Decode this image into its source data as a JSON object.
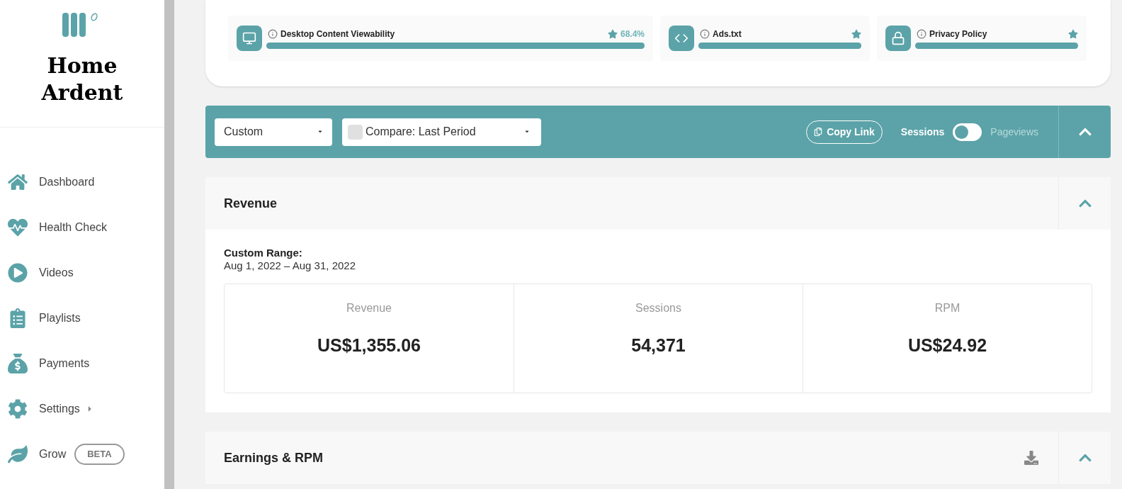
{
  "brand": {
    "name_lines": [
      "Home",
      "Ardent"
    ]
  },
  "sidebar": {
    "items": [
      {
        "label": "Dashboard"
      },
      {
        "label": "Health Check"
      },
      {
        "label": "Videos"
      },
      {
        "label": "Playlists"
      },
      {
        "label": "Payments"
      },
      {
        "label": "Settings",
        "submenu": true
      },
      {
        "label": "Grow",
        "badge": "BETA"
      }
    ]
  },
  "health_items": [
    {
      "name": "Desktop Content Viewability",
      "value": "68.4%",
      "level": 1
    },
    {
      "name": "Ads.txt",
      "level": 1
    },
    {
      "name": "Privacy Policy",
      "level": 1
    }
  ],
  "toolbar": {
    "range": "Custom",
    "compare": "Compare: Last Period",
    "compare_checked": false,
    "copy_link": "Copy Link",
    "metric_options": [
      {
        "label": "Sessions",
        "selected": true
      },
      {
        "label": "Pageviews",
        "selected": false
      }
    ],
    "expanded": true
  },
  "revenue": {
    "title": "Revenue",
    "expanded": true,
    "range_label": "Custom Range:",
    "range": "Aug 1, 2022 – Aug 31, 2022",
    "stats": [
      {
        "label": "Revenue",
        "value": "US$1,355.06"
      },
      {
        "label": "Sessions",
        "value": "54,371"
      },
      {
        "label": "RPM",
        "value": "US$24.92"
      }
    ]
  },
  "earnings": {
    "title": "Earnings & RPM",
    "expanded": true
  }
}
